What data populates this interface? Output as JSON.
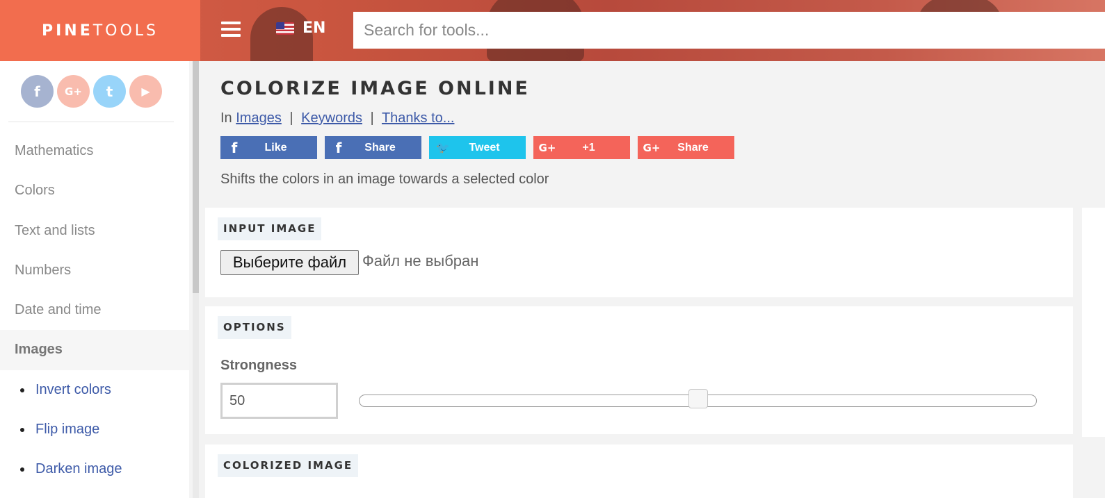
{
  "header": {
    "logo_bold": "PINE",
    "logo_light": "TOOLS",
    "menu_icon": "hamburger-icon",
    "language": "EN",
    "search_placeholder": "Search for tools..."
  },
  "sidebar": {
    "social": [
      {
        "name": "facebook",
        "glyph": "f"
      },
      {
        "name": "google-plus",
        "glyph": "G+"
      },
      {
        "name": "twitter",
        "glyph": "t"
      },
      {
        "name": "youtube",
        "glyph": "▶"
      }
    ],
    "categories": [
      "Mathematics",
      "Colors",
      "Text and lists",
      "Numbers",
      "Date and time",
      "Images"
    ],
    "active_category": "Images",
    "subitems": [
      "Invert colors",
      "Flip image",
      "Darken image"
    ]
  },
  "main": {
    "title": "COLORIZE IMAGE ONLINE",
    "crumb_prefix": "In",
    "crumbs": [
      "Images",
      "Keywords",
      "Thanks to..."
    ],
    "crumb_sep": "|",
    "share_buttons": [
      {
        "icon": "f",
        "label": "Like",
        "style": "fb"
      },
      {
        "icon": "f",
        "label": "Share",
        "style": "fb"
      },
      {
        "icon": "🐦",
        "label": "Tweet",
        "style": "tw"
      },
      {
        "icon": "G+",
        "label": "+1",
        "style": "gp"
      },
      {
        "icon": "G+",
        "label": "Share",
        "style": "gp"
      }
    ],
    "description": "Shifts the colors in an image towards a selected color",
    "input_panel": {
      "label": "INPUT IMAGE",
      "file_button": "Выберите файл",
      "file_status": "Файл не выбран"
    },
    "options_panel": {
      "label": "OPTIONS",
      "strongness_label": "Strongness",
      "strongness_value": "50",
      "slider_fraction": 0.5
    },
    "output_panel": {
      "label": "COLORIZED IMAGE"
    }
  },
  "colors": {
    "accent": "#f26d4e",
    "link": "#3d5aa8",
    "facebook": "#4a6fb5",
    "twitter": "#1ec4ec",
    "google": "#f4645a"
  }
}
